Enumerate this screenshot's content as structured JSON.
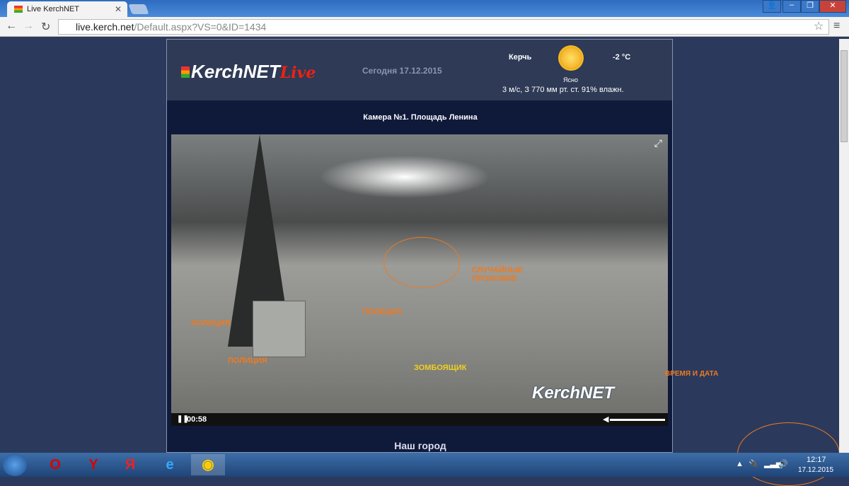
{
  "browser": {
    "tab_title": "Live KerchNET",
    "url_host": "live.kerch.net",
    "url_path": "/Default.aspx?VS=0&ID=1434"
  },
  "header": {
    "logo": "KerchNET",
    "logo_live": "Live",
    "today": "Сегодня 17.12.2015",
    "city": "Керчь",
    "temperature": "-2 °C",
    "condition": "Ясно",
    "weather_details": "3 м/с, З  770 мм рт. ст.  91% влажн."
  },
  "camera": {
    "title": "Камера №1. Площадь Ленина",
    "watermark": "KerchNET",
    "time": "00:58"
  },
  "annotations": {
    "random": "СЛУЧАЙНЫЕ ПРОХОЖИЕ",
    "police1": "ПОЛИЦИЯ",
    "police2": "ПОЛИЦИЯ",
    "police3": "ПОЛИЦИЯ",
    "zombie": "ЗОМБОЯЩИК",
    "timedate": "ВРЕМЯ И ДАТА"
  },
  "section": "Наш город",
  "taskbar": {
    "time": "12:17",
    "date": "17.12.2015"
  }
}
